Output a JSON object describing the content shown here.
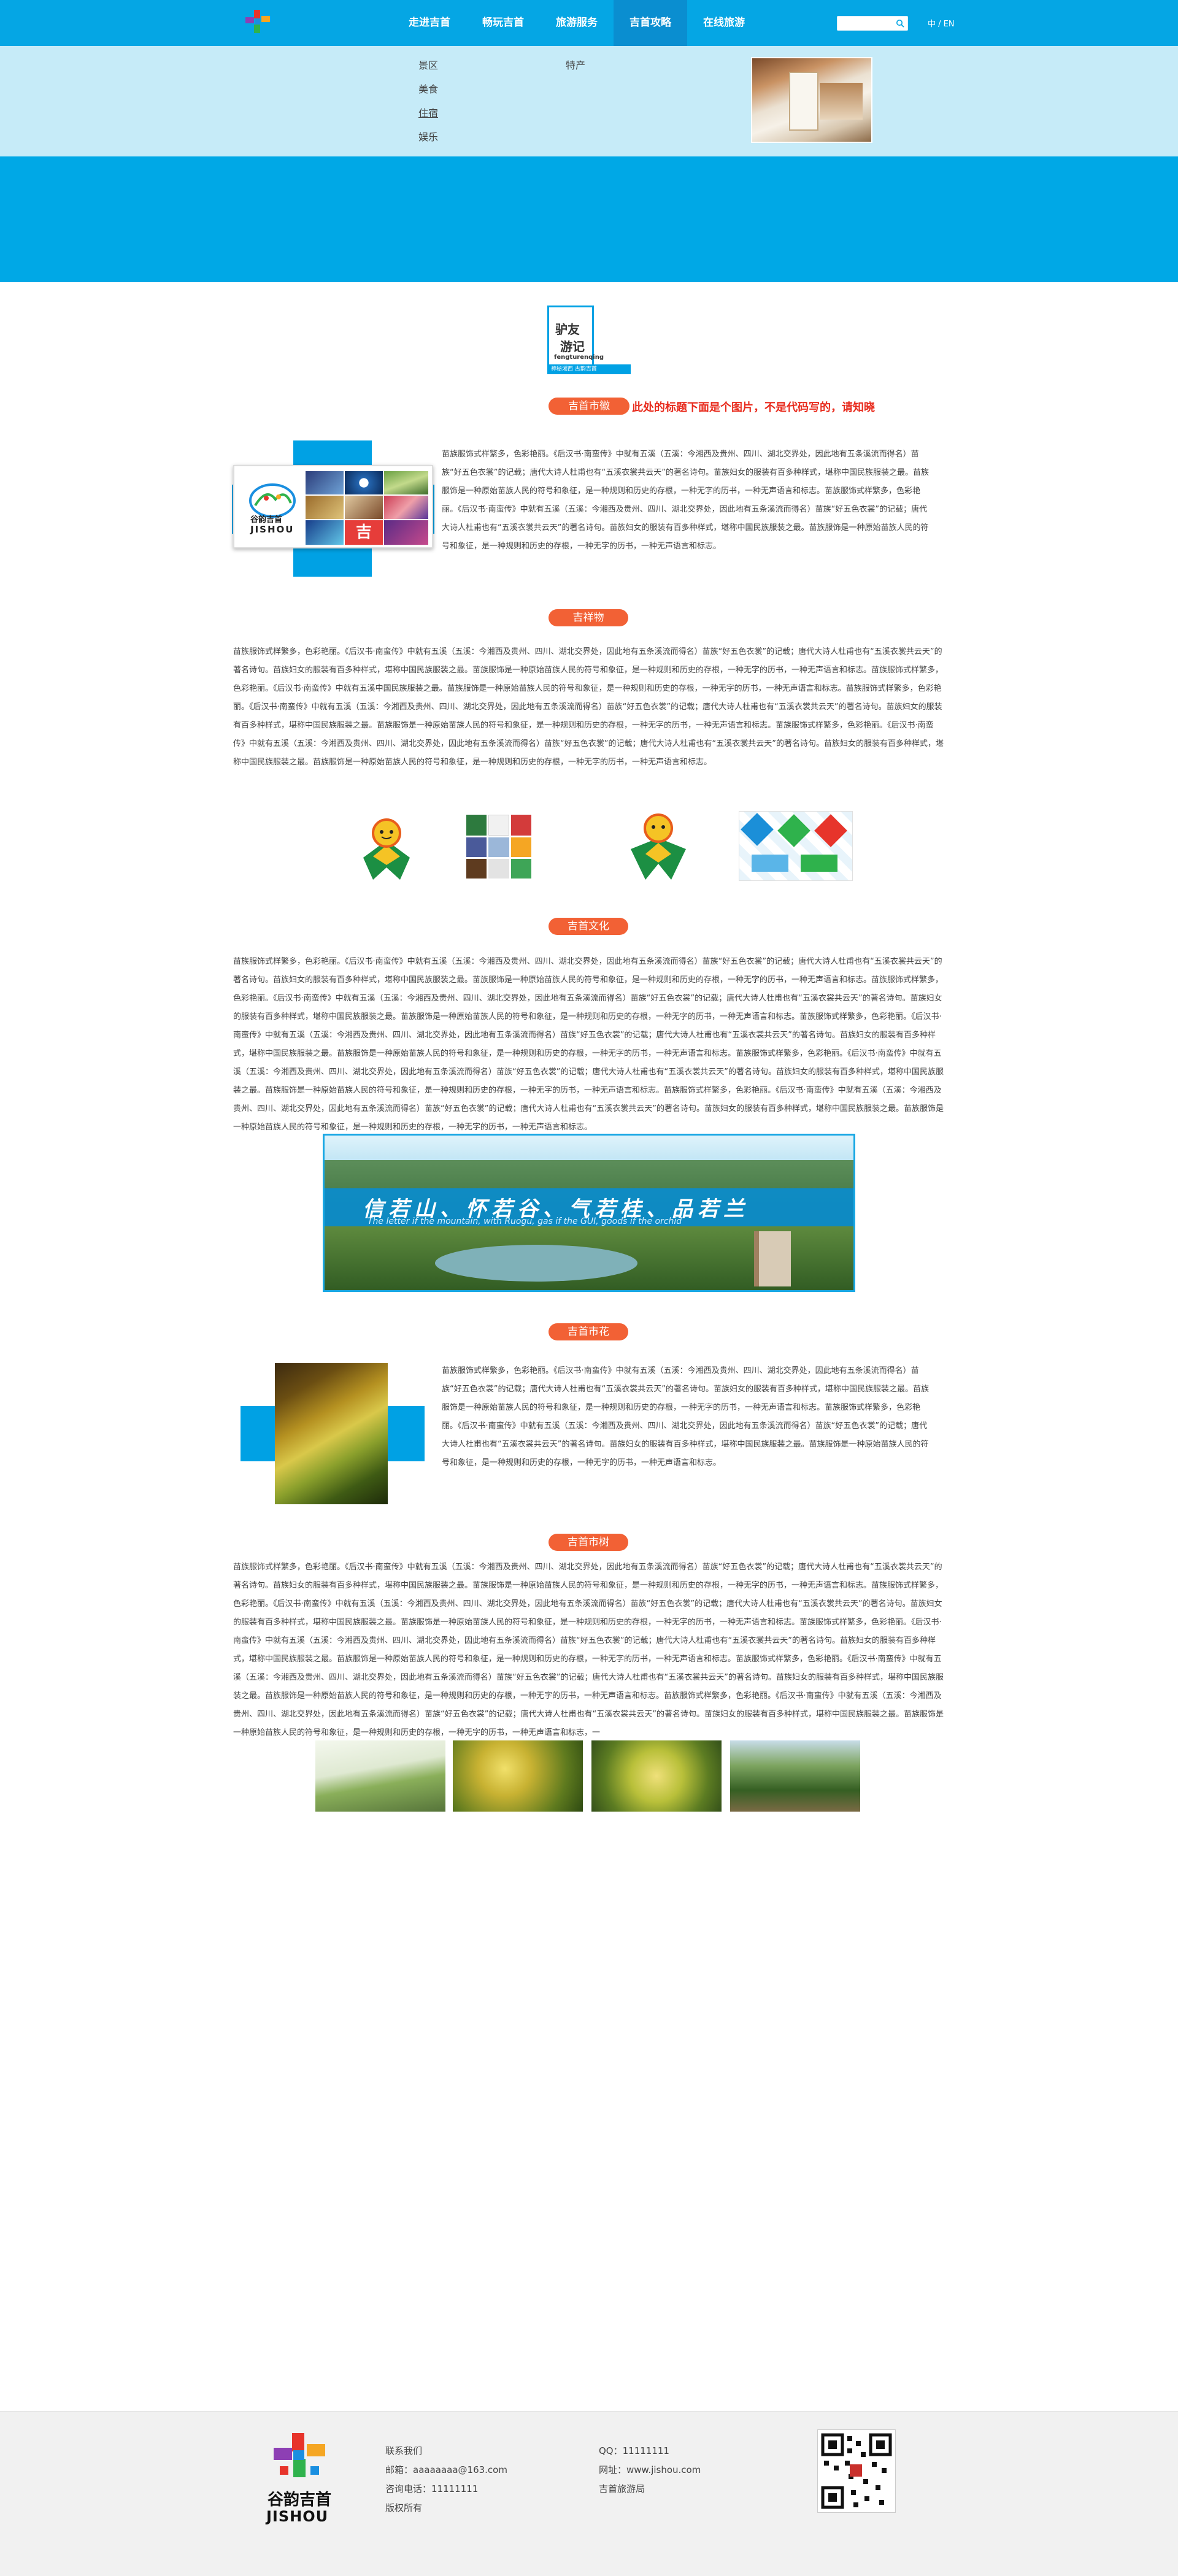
{
  "header": {
    "nav": [
      "走进吉首",
      "畅玩吉首",
      "旅游服务",
      "吉首攻略",
      "在线旅游"
    ],
    "active_index": 3,
    "search": {
      "placeholder": ""
    },
    "lang": "中 / EN"
  },
  "dropdown": {
    "col1": [
      "景区",
      "美食",
      "住宿",
      "娱乐"
    ],
    "col2": [
      "特产"
    ],
    "selected": "住宿"
  },
  "badge": {
    "line1": "驴友",
    "line2": "游记",
    "pinyin": "fengturenqing",
    "strip": "神秘湘西 古韵吉首"
  },
  "sections": {
    "city_emblem": {
      "title": "吉首市徽",
      "note": "此处的标题下面是个图片，不是代码写的，请知晓",
      "logo_text": "JISHOU",
      "logo_cn": "谷韵吉首",
      "paragraph": "苗族服饰式样繁多，色彩艳丽。《后汉书·南蛮传》中就有五溪（五溪：今湘西及贵州、四川、湖北交界处，因此地有五条溪流而得名）苗族“好五色衣裳”的记载；唐代大诗人杜甫也有“五溪衣裳共云天”的著名诗句。苗族妇女的服装有百多种样式，堪称中国民族服装之最。苗族服饰是一种原始苗族人民的符号和象征，是一种规则和历史的存根，一种无字的历书，一种无声语言和标志。苗族服饰式样繁多，色彩艳丽。《后汉书·南蛮传》中就有五溪（五溪：今湘西及贵州、四川、湖北交界处，因此地有五条溪流而得名）苗族“好五色衣裳”的记载；唐代大诗人杜甫也有“五溪衣裳共云天”的著名诗句。苗族妇女的服装有百多种样式，堪称中国民族服装之最。苗族服饰是一种原始苗族人民的符号和象征，是一种规则和历史的存根，一种无字的历书，一种无声语言和标志。"
    },
    "mascot": {
      "title": "吉祥物",
      "paragraph": "苗族服饰式样繁多，色彩艳丽。《后汉书·南蛮传》中就有五溪（五溪：今湘西及贵州、四川、湖北交界处，因此地有五条溪流而得名）苗族“好五色衣裳”的记载；唐代大诗人杜甫也有“五溪衣裳共云天”的著名诗句。苗族妇女的服装有百多种样式，堪称中国民族服装之最。苗族服饰是一种原始苗族人民的符号和象征，是一种规则和历史的存根，一种无字的历书，一种无声语言和标志。苗族服饰式样繁多，色彩艳丽。《后汉书·南蛮传》中就有五溪中国民族服装之最。苗族服饰是一种原始苗族人民的符号和象征，是一种规则和历史的存根，一种无字的历书，一种无声语言和标志。苗族服饰式样繁多，色彩艳丽。《后汉书·南蛮传》中就有五溪（五溪：今湘西及贵州、四川、湖北交界处，因此地有五条溪流而得名）苗族“好五色衣裳”的记载；唐代大诗人杜甫也有“五溪衣裳共云天”的著名诗句。苗族妇女的服装有百多种样式，堪称中国民族服装之最。苗族服饰是一种原始苗族人民的符号和象征，是一种规则和历史的存根，一种无字的历书，一种无声语言和标志。苗族服饰式样繁多，色彩艳丽。《后汉书·南蛮传》中就有五溪（五溪：今湘西及贵州、四川、湖北交界处，因此地有五条溪流而得名）苗族“好五色衣裳”的记载；唐代大诗人杜甫也有“五溪衣裳共云天”的著名诗句。苗族妇女的服装有百多种样式，堪称中国民族服装之最。苗族服饰是一种原始苗族人民的符号和象征，是一种规则和历史的存根，一种无字的历书，一种无声语言和标志。"
    },
    "culture": {
      "title": "吉首文化",
      "paragraph": "苗族服饰式样繁多，色彩艳丽。《后汉书·南蛮传》中就有五溪（五溪：今湘西及贵州、四川、湖北交界处，因此地有五条溪流而得名）苗族“好五色衣裳”的记载；唐代大诗人杜甫也有“五溪衣裳共云天”的著名诗句。苗族妇女的服装有百多种样式，堪称中国民族服装之最。苗族服饰是一种原始苗族人民的符号和象征，是一种规则和历史的存根，一种无字的历书，一种无声语言和标志。苗族服饰式样繁多，色彩艳丽。《后汉书·南蛮传》中就有五溪（五溪：今湘西及贵州、四川、湖北交界处，因此地有五条溪流而得名）苗族“好五色衣裳”的记载；唐代大诗人杜甫也有“五溪衣裳共云天”的著名诗句。苗族妇女的服装有百多种样式，堪称中国民族服装之最。苗族服饰是一种原始苗族人民的符号和象征，是一种规则和历史的存根，一种无字的历书，一种无声语言和标志。苗族服饰式样繁多，色彩艳丽。《后汉书·南蛮传》中就有五溪（五溪：今湘西及贵州、四川、湖北交界处，因此地有五条溪流而得名）苗族“好五色衣裳”的记载；唐代大诗人杜甫也有“五溪衣裳共云天”的著名诗句。苗族妇女的服装有百多种样式，堪称中国民族服装之最。苗族服饰是一种原始苗族人民的符号和象征，是一种规则和历史的存根，一种无字的历书，一种无声语言和标志。苗族服饰式样繁多，色彩艳丽。《后汉书·南蛮传》中就有五溪（五溪：今湘西及贵州、四川、湖北交界处，因此地有五条溪流而得名）苗族“好五色衣裳”的记载；唐代大诗人杜甫也有“五溪衣裳共云天”的著名诗句。苗族妇女的服装有百多种样式，堪称中国民族服装之最。苗族服饰是一种原始苗族人民的符号和象征，是一种规则和历史的存根，一种无字的历书，一种无声语言和标志。苗族服饰式样繁多，色彩艳丽。《后汉书·南蛮传》中就有五溪（五溪：今湘西及贵州、四川、湖北交界处，因此地有五条溪流而得名）苗族“好五色衣裳”的记载；唐代大诗人杜甫也有“五溪衣裳共云天”的著名诗句。苗族妇女的服装有百多种样式，堪称中国民族服装之最。苗族服饰是一种原始苗族人民的符号和象征，是一种规则和历史的存根，一种无字的历书，一种无声语言和标志。",
      "banner_cn": "信若山、怀若谷、气若桂、品若兰",
      "banner_en": "The letter if the mountain, with Ruogu, gas if the GUI, goods if the orchid"
    },
    "city_flower": {
      "title": "吉首市花",
      "paragraph": "苗族服饰式样繁多，色彩艳丽。《后汉书·南蛮传》中就有五溪（五溪：今湘西及贵州、四川、湖北交界处，因此地有五条溪流而得名）苗族“好五色衣裳”的记载；唐代大诗人杜甫也有“五溪衣裳共云天”的著名诗句。苗族妇女的服装有百多种样式，堪称中国民族服装之最。苗族服饰是一种原始苗族人民的符号和象征，是一种规则和历史的存根，一种无字的历书，一种无声语言和标志。苗族服饰式样繁多，色彩艳丽。《后汉书·南蛮传》中就有五溪（五溪：今湘西及贵州、四川、湖北交界处，因此地有五条溪流而得名）苗族“好五色衣裳”的记载；唐代大诗人杜甫也有“五溪衣裳共云天”的著名诗句。苗族妇女的服装有百多种样式，堪称中国民族服装之最。苗族服饰是一种原始苗族人民的符号和象征，是一种规则和历史的存根，一种无字的历书，一种无声语言和标志。"
    },
    "city_tree": {
      "title": "吉首市树",
      "paragraph": "苗族服饰式样繁多，色彩艳丽。《后汉书·南蛮传》中就有五溪（五溪：今湘西及贵州、四川、湖北交界处，因此地有五条溪流而得名）苗族“好五色衣裳”的记载；唐代大诗人杜甫也有“五溪衣裳共云天”的著名诗句。苗族妇女的服装有百多种样式，堪称中国民族服装之最。苗族服饰是一种原始苗族人民的符号和象征，是一种规则和历史的存根，一种无字的历书，一种无声语言和标志。苗族服饰式样繁多，色彩艳丽。《后汉书·南蛮传》中就有五溪（五溪：今湘西及贵州、四川、湖北交界处，因此地有五条溪流而得名）苗族“好五色衣裳”的记载；唐代大诗人杜甫也有“五溪衣裳共云天”的著名诗句。苗族妇女的服装有百多种样式，堪称中国民族服装之最。苗族服饰是一种原始苗族人民的符号和象征，是一种规则和历史的存根，一种无字的历书，一种无声语言和标志。苗族服饰式样繁多，色彩艳丽。《后汉书·南蛮传》中就有五溪（五溪：今湘西及贵州、四川、湖北交界处，因此地有五条溪流而得名）苗族“好五色衣裳”的记载；唐代大诗人杜甫也有“五溪衣裳共云天”的著名诗句。苗族妇女的服装有百多种样式，堪称中国民族服装之最。苗族服饰是一种原始苗族人民的符号和象征，是一种规则和历史的存根，一种无字的历书，一种无声语言和标志。苗族服饰式样繁多，色彩艳丽。《后汉书·南蛮传》中就有五溪（五溪：今湘西及贵州、四川、湖北交界处，因此地有五条溪流而得名）苗族“好五色衣裳”的记载；唐代大诗人杜甫也有“五溪衣裳共云天”的著名诗句。苗族妇女的服装有百多种样式，堪称中国民族服装之最。苗族服饰是一种原始苗族人民的符号和象征，是一种规则和历史的存根，一种无字的历书，一种无声语言和标志。苗族服饰式样繁多，色彩艳丽。《后汉书·南蛮传》中就有五溪（五溪：今湘西及贵州、四川、湖北交界处，因此地有五条溪流而得名）苗族“好五色衣裳”的记载；唐代大诗人杜甫也有“五溪衣裳共云天”的著名诗句。苗族妇女的服装有百多种样式，堪称中国民族服装之最。苗族服饰是一种原始苗族人民的符号和象征，是一种规则和历史的存根，一种无字的历书，一种无声语言和标志，一"
    }
  },
  "footer": {
    "logo_cn": "谷韵吉首",
    "logo_en": "JISHOU",
    "left": [
      "联系我们",
      "邮箱：aaaaaaaa@163.com",
      "咨询电话：11111111",
      "版权所有"
    ],
    "right": [
      "QQ：11111111",
      "网址：www.jishou.com",
      "吉首旅游局"
    ]
  },
  "colors": {
    "primary": "#05a6e4",
    "accent": "#f26135",
    "note": "#e82b1d"
  }
}
